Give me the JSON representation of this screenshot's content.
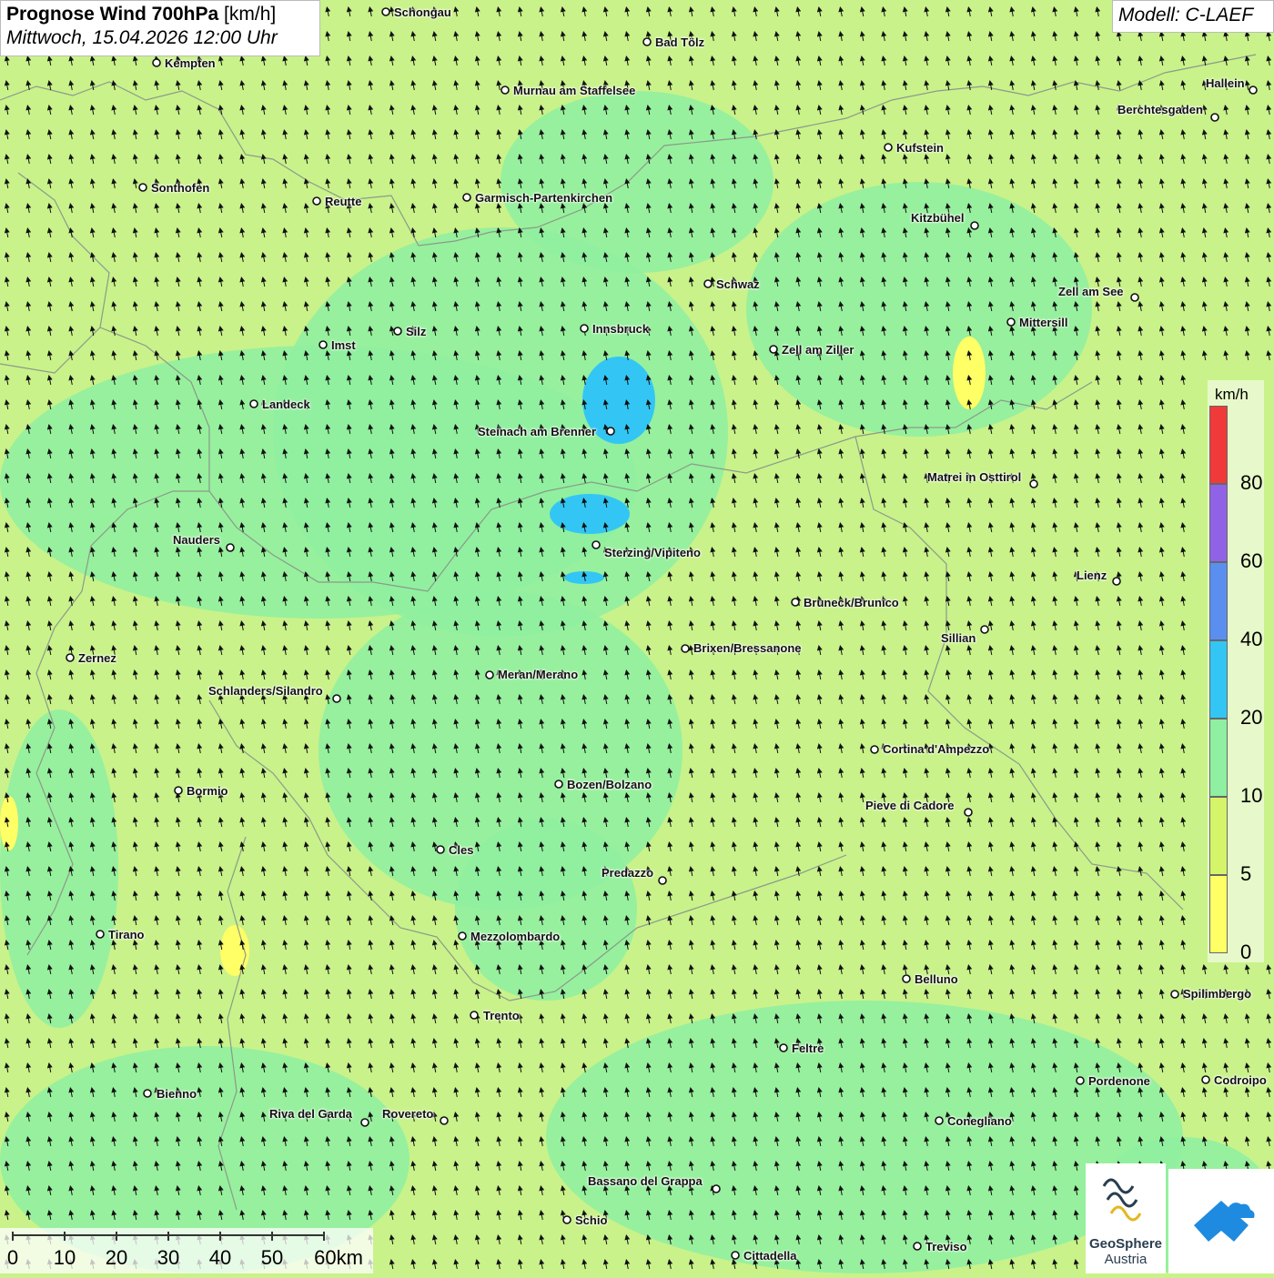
{
  "header": {
    "title_bold": "Prognose Wind 700hPa",
    "title_unit": "[km/h]",
    "datetime": "Mittwoch, 15.04.2026 12:00 Uhr",
    "model": "Modell: C-LAEF"
  },
  "legend": {
    "unit": "km/h",
    "classes": [
      {
        "label": "0",
        "color": "#ffff66"
      },
      {
        "label": "5",
        "color": "#d4f56a"
      },
      {
        "label": "10",
        "color": "#8ef0a0"
      },
      {
        "label": "20",
        "color": "#33c6f4"
      },
      {
        "label": "40",
        "color": "#5a8ff0"
      },
      {
        "label": "60",
        "color": "#9063e6"
      },
      {
        "label": "80",
        "color": "#f03a3a"
      }
    ]
  },
  "scalebar": {
    "labels": [
      "0",
      "10",
      "20",
      "30",
      "40",
      "50",
      "60km"
    ]
  },
  "logos": {
    "geosphere_name": "GeoSphere",
    "geosphere_sub": "Austria"
  },
  "wind_field": {
    "prevailing_direction": "from south (arrows pointing north / north-northwest)",
    "arrow_icon": "wind-arrow-icon"
  },
  "cities": [
    {
      "name": "Schongau"
    },
    {
      "name": "Bad Tölz"
    },
    {
      "name": "Kempten"
    },
    {
      "name": "Murnau am Staffelsee"
    },
    {
      "name": "Hallein"
    },
    {
      "name": "Berchtesgaden"
    },
    {
      "name": "Kufstein"
    },
    {
      "name": "Sonthofen"
    },
    {
      "name": "Reutte"
    },
    {
      "name": "Garmisch-Partenkirchen"
    },
    {
      "name": "Kitzbühel"
    },
    {
      "name": "Schwaz"
    },
    {
      "name": "Zell am See"
    },
    {
      "name": "Mittersill"
    },
    {
      "name": "Innsbruck"
    },
    {
      "name": "Silz"
    },
    {
      "name": "Imst"
    },
    {
      "name": "Zell am Ziller"
    },
    {
      "name": "Landeck"
    },
    {
      "name": "Steinach am Brenner"
    },
    {
      "name": "Matrei in Osttirol"
    },
    {
      "name": "Nauders"
    },
    {
      "name": "Sterzing/Vipiteno"
    },
    {
      "name": "Lienz"
    },
    {
      "name": "Bruneck/Brunico"
    },
    {
      "name": "Sillian"
    },
    {
      "name": "Zernez"
    },
    {
      "name": "Brixen/Bressanone"
    },
    {
      "name": "Meran/Merano"
    },
    {
      "name": "Schlanders/Silandro"
    },
    {
      "name": "Cortina d'Ampezzo"
    },
    {
      "name": "Bozen/Bolzano"
    },
    {
      "name": "Bormio"
    },
    {
      "name": "Pieve di Cadore"
    },
    {
      "name": "Cles"
    },
    {
      "name": "Predazzo"
    },
    {
      "name": "Tirano"
    },
    {
      "name": "Mezzolombardo"
    },
    {
      "name": "Belluno"
    },
    {
      "name": "Spilimbergo"
    },
    {
      "name": "Trento"
    },
    {
      "name": "Feltre"
    },
    {
      "name": "Pordenone"
    },
    {
      "name": "Codroipo"
    },
    {
      "name": "Bienno"
    },
    {
      "name": "Riva del Garda"
    },
    {
      "name": "Rovereto"
    },
    {
      "name": "Conegliano"
    },
    {
      "name": "Bassano del Grappa"
    },
    {
      "name": "Schio"
    },
    {
      "name": "Treviso"
    },
    {
      "name": "Cittadella"
    }
  ]
}
